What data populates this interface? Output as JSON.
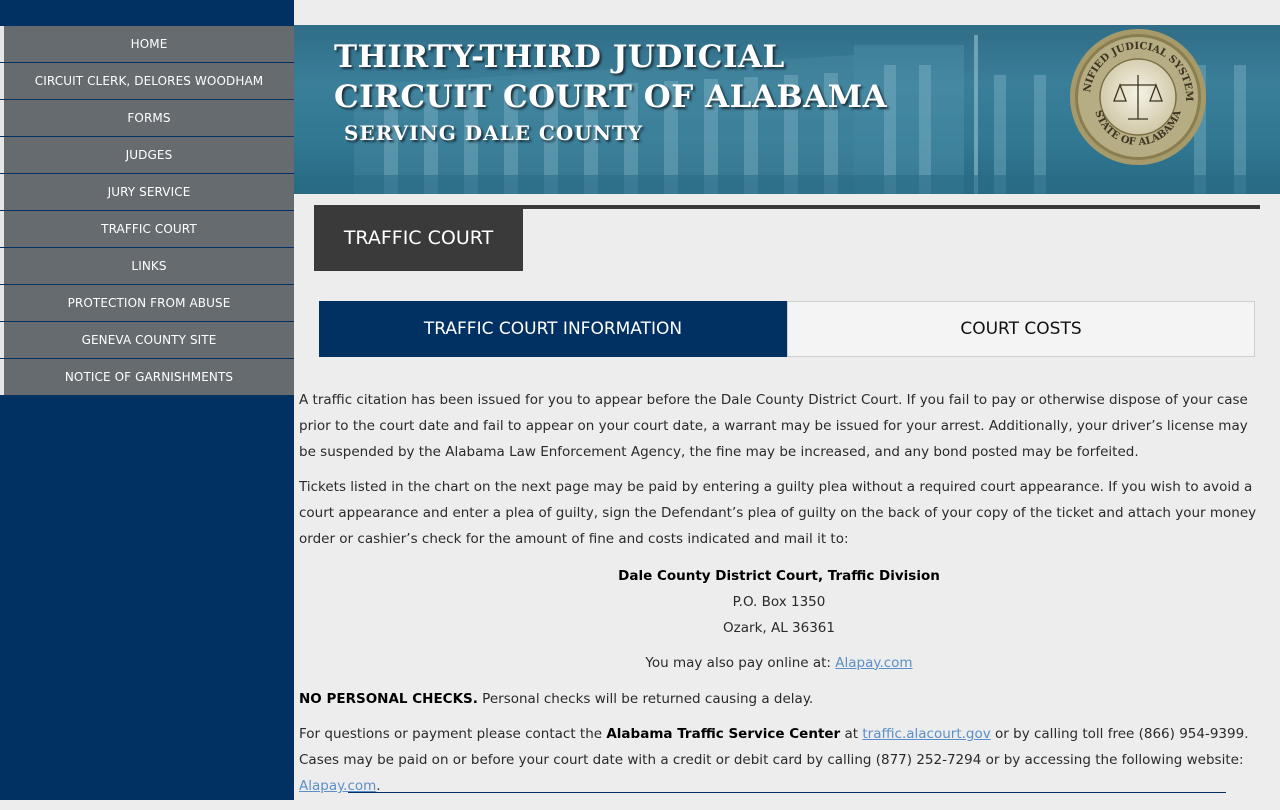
{
  "nav": {
    "items": [
      {
        "label": "HOME"
      },
      {
        "label": "CIRCUIT CLERK, DELORES WOODHAM"
      },
      {
        "label": "FORMS"
      },
      {
        "label": "JUDGES"
      },
      {
        "label": "JURY SERVICE"
      },
      {
        "label": "TRAFFIC COURT"
      },
      {
        "label": "LINKS"
      },
      {
        "label": "PROTECTION FROM ABUSE"
      },
      {
        "label": "GENEVA COUNTY SITE"
      },
      {
        "label": "NOTICE OF GARNISHMENTS"
      }
    ]
  },
  "banner": {
    "title_line1": "THIRTY-THIRD JUDICIAL",
    "title_line2": "CIRCUIT COURT OF ALABAMA",
    "subtitle": "SERVING DALE COUNTY",
    "seal_top": "UNIFIED JUDICIAL SYSTEM",
    "seal_bottom": "STATE OF ALABAMA"
  },
  "page": {
    "title": "TRAFFIC COURT"
  },
  "tabs": [
    {
      "label": "TRAFFIC COURT INFORMATION",
      "active": true
    },
    {
      "label": "COURT COSTS",
      "active": false
    }
  ],
  "content": {
    "para1": "A traffic citation has been issued for you to appear before the Dale County District Court. If you fail to pay or otherwise dispose of your case prior to the court date and fail to appear on your court date, a warrant may be issued for your arrest. Additionally, your driver’s license may be suspended by the Alabama Law Enforcement Agency, the fine may be increased, and any bond posted may be forfeited.",
    "para2": "Tickets listed in the chart on the next page may be paid by entering a guilty plea without a required court appearance. If you wish to avoid a court appearance and enter a plea of guilty, sign the Defendant’s plea of guilty on the back of your copy of the ticket and attach your money order or cashier’s check for the amount of fine and costs indicated and mail it to:",
    "address": {
      "name": "Dale County District Court, Traffic Division",
      "line1": "P.O. Box 1350",
      "line2": "Ozark, AL 36361"
    },
    "online_prefix": "You may also pay online at: ",
    "online_link": "Alapay.com",
    "no_checks_bold": "NO PERSONAL CHECKS.",
    "no_checks_text": " Personal checks will be returned causing a delay.",
    "contact_prefix": "For questions or payment please contact the ",
    "contact_bold": "Alabama Traffic Service Center",
    "contact_at": " at ",
    "contact_link": "traffic.alacourt.gov",
    "contact_mid": " or by calling toll free (866) 954-9399. Cases may be paid on or before your court date with a credit or debit card by calling (877) 252-7294 or by accessing the following website: ",
    "contact_link2": "Alapay.com",
    "contact_end": "."
  }
}
